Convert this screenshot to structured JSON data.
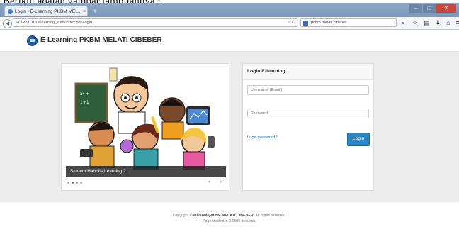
{
  "caption": "Berikut adalah gambar tampilannya :",
  "browser": {
    "tab_title": "Login - E-Learning PKBM MEL...",
    "tab_close": "×",
    "new_tab": "+",
    "url_host": "127.0.0.1",
    "url_path": "/elearning_sofa/index.php/login",
    "url_suffix_icons": "▿ C",
    "search_query": "pkbm melati cibeber",
    "window_min": "–",
    "window_max": "□",
    "window_close": "✕"
  },
  "header": {
    "title": "E-Learning PKBM MELATI CIBEBER"
  },
  "slider": {
    "caption": "Student Habbits Learning 2",
    "dots": 4,
    "active_dot": 1,
    "prev": "‹",
    "next": "›"
  },
  "login": {
    "heading": "Login E-learning",
    "username_placeholder": "Username (Email)",
    "password_placeholder": "Password",
    "forgot": "Lupa password?",
    "button": "Login"
  },
  "footer": {
    "line1_prefix": "Copyright © ",
    "line1_owner": "Maisofa (PKBM MELATI CIBEBER)",
    "line1_suffix": " All rights reserved.",
    "line2": "Page loaded in 0.6590 seconds."
  }
}
